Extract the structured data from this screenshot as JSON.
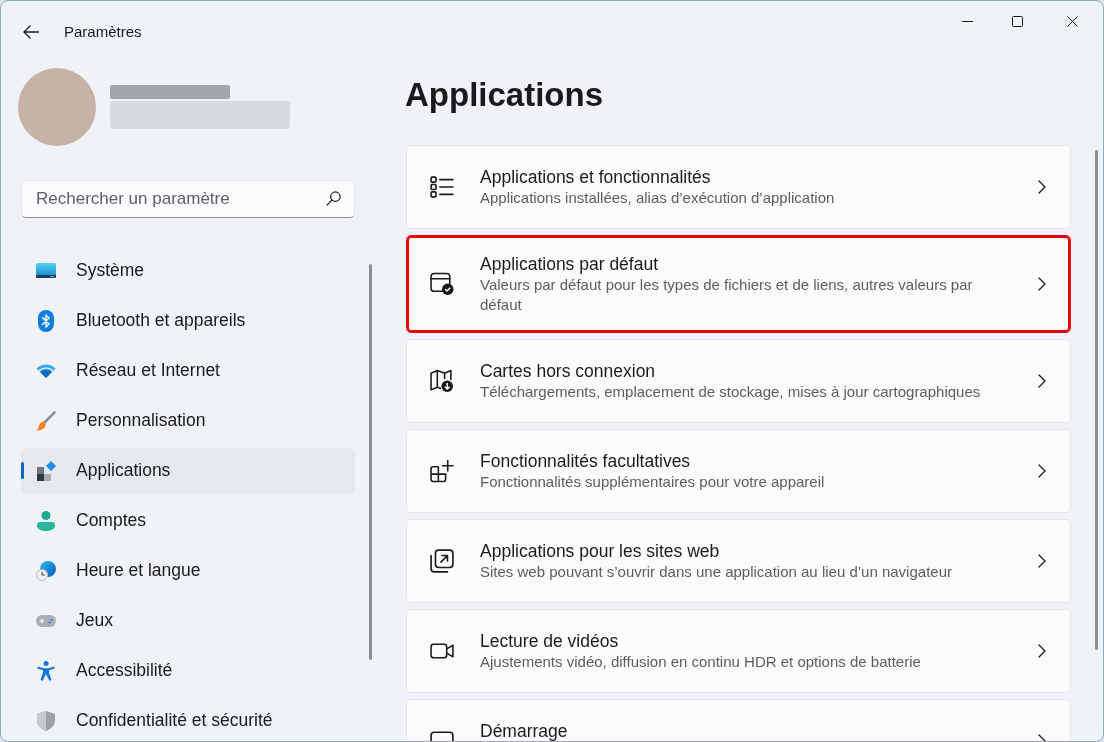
{
  "window": {
    "title": "Paramètres"
  },
  "search": {
    "placeholder": "Rechercher un paramètre"
  },
  "nav": [
    {
      "kind": "system",
      "label": "Système",
      "selected": false
    },
    {
      "kind": "bluetooth",
      "label": "Bluetooth et appareils",
      "selected": false
    },
    {
      "kind": "network",
      "label": "Réseau et Internet",
      "selected": false
    },
    {
      "kind": "personalization",
      "label": "Personnalisation",
      "selected": false
    },
    {
      "kind": "apps",
      "label": "Applications",
      "selected": true
    },
    {
      "kind": "accounts",
      "label": "Comptes",
      "selected": false
    },
    {
      "kind": "time-language",
      "label": "Heure et langue",
      "selected": false
    },
    {
      "kind": "gaming",
      "label": "Jeux",
      "selected": false
    },
    {
      "kind": "accessibility",
      "label": "Accessibilité",
      "selected": false
    },
    {
      "kind": "privacy",
      "label": "Confidentialité et sécurité",
      "selected": false
    }
  ],
  "page": {
    "title": "Applications"
  },
  "cards": [
    {
      "kind": "list",
      "title": "Applications et fonctionnalités",
      "description": "Applications installées, alias d’exécution d’application",
      "highlighted": false
    },
    {
      "kind": "default-apps",
      "title": "Applications par défaut",
      "description": "Valeurs par défaut pour les types de fichiers et de liens, autres valeurs par défaut",
      "highlighted": true
    },
    {
      "kind": "offline-maps",
      "title": "Cartes hors connexion",
      "description": "Téléchargements, emplacement de stockage, mises à jour cartographiques",
      "highlighted": false
    },
    {
      "kind": "optional-features",
      "title": "Fonctionnalités facultatives",
      "description": "Fonctionnalités supplémentaires pour votre appareil",
      "highlighted": false
    },
    {
      "kind": "web-apps",
      "title": "Applications pour les sites web",
      "description": "Sites web pouvant s’ouvrir dans une application au lieu d’un navigateur",
      "highlighted": false
    },
    {
      "kind": "video",
      "title": "Lecture de vidéos",
      "description": "Ajustements vidéo, diffusion en continu HDR et options de batterie",
      "highlighted": false
    },
    {
      "kind": "startup",
      "title": "Démarrage",
      "highlighted": false
    }
  ]
}
